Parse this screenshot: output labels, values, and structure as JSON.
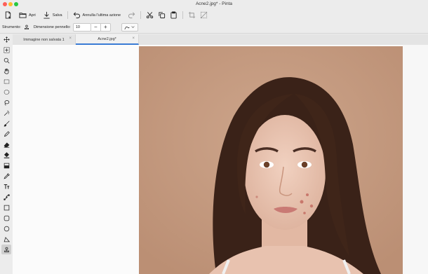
{
  "window": {
    "title": "Acne2.jpg* - Pinta"
  },
  "toolbar": {
    "new_icon": "new-image-icon",
    "open_label": "Apri",
    "save_label": "Salva",
    "undo_label": "Annulla l'ultima azione",
    "redo_icon": "redo-icon",
    "cut_icon": "scissors-icon",
    "copy_icon": "copy-icon",
    "paste_icon": "paste-icon",
    "crop_icon": "crop-icon",
    "deselect_icon": "deselect-icon"
  },
  "tool_options": {
    "tool_label": "Strumento:",
    "brush_size_label": "Dimensione pennello:",
    "brush_size_value": "10",
    "minus": "−",
    "plus": "+"
  },
  "tools": [
    "move-selected-icon",
    "move-selection-icon",
    "zoom-icon",
    "pan-icon",
    "rectangle-select-icon",
    "ellipse-select-icon",
    "lasso-select-icon",
    "magic-wand-icon",
    "paintbrush-icon",
    "pencil-icon",
    "eraser-icon",
    "paint-bucket-icon",
    "gradient-icon",
    "color-picker-icon",
    "text-icon",
    "line-curve-icon",
    "rectangle-icon",
    "rounded-rectangle-icon",
    "ellipse-icon",
    "freeform-shape-icon",
    "clone-stamp-icon"
  ],
  "tabs": [
    {
      "label": "Immagine non salvata 1",
      "close": "×"
    },
    {
      "label": "Acne2.jpg*",
      "close": "×"
    }
  ],
  "colors": {
    "accent": "#3a7bd5",
    "photo_background": "#c49a7f"
  }
}
